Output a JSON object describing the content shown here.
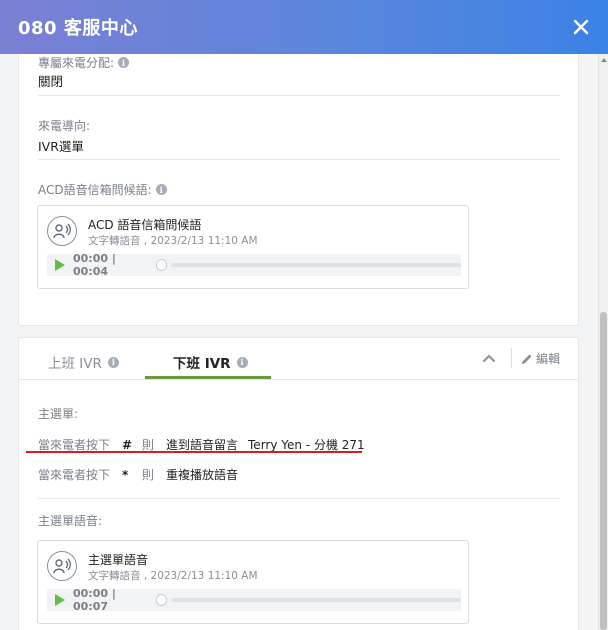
{
  "header": {
    "title": "080 客服中心"
  },
  "settings": {
    "dedicated_label": "專屬來電分配:",
    "dedicated_value": "關閉",
    "routing_label": "來電導向:",
    "routing_value": "IVR選單",
    "acd_greeting_label": "ACD語音信箱問候語:"
  },
  "acd_audio": {
    "title": "ACD 語音信箱問候語",
    "subtitle": "文字轉語音 , 2023/2/13 11:10 AM",
    "time": "00:00 | 00:04",
    "progress": 0
  },
  "ivr": {
    "tabs": [
      {
        "label": "上班 IVR",
        "active": false
      },
      {
        "label": "下班 IVR",
        "active": true
      }
    ],
    "edit_label": "編輯",
    "main_menu_label": "主選單:",
    "rules": [
      {
        "prefix": "當來電者按下",
        "key": "#",
        "then": "則",
        "action": "進到語音留言",
        "extension": "Terry Yen - 分機 271"
      },
      {
        "prefix": "當來電者按下",
        "key": "*",
        "then": "則",
        "action": "重複播放語音",
        "extension": ""
      }
    ],
    "main_audio_label": "主選單語音:"
  },
  "main_audio": {
    "title": "主選單語音",
    "subtitle": "文字轉語音 , 2023/2/13 11:10 AM",
    "time": "00:00 | 00:07",
    "progress": 0
  },
  "colors": {
    "header_start": "#7b80d4",
    "header_end": "#3b82e6",
    "play": "#5fbf4a",
    "tab_active": "#6a9b3b",
    "annotation": "#d81e1e"
  }
}
